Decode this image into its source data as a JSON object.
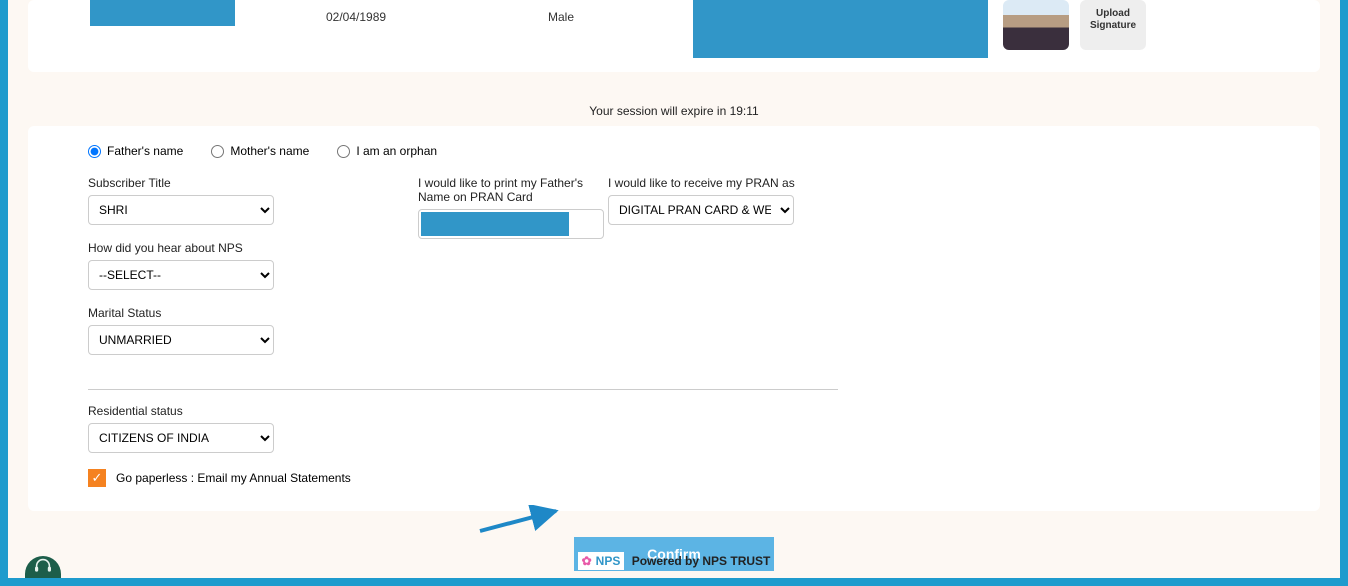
{
  "top": {
    "dob": "02/04/1989",
    "gender": "Male",
    "sig_line1": "Upload",
    "sig_line2": "Signature"
  },
  "session": {
    "prefix": "Your session will expire in ",
    "time": "19:11"
  },
  "radios": {
    "fathers": "Father's name",
    "mothers": "Mother's name",
    "orphan": "I am an orphan"
  },
  "labels": {
    "subscriber_title": "Subscriber Title",
    "print_father": "I would like to print my Father's Name on PRAN Card",
    "receive_pran_as": "I would like to receive my PRAN as",
    "how_hear": "How did you hear about NPS",
    "marital_status": "Marital Status",
    "residential_status": "Residential status",
    "paperless": "Go paperless : Email my Annual Statements"
  },
  "values": {
    "subscriber_title": "SHRI",
    "receive_pran_as": "DIGITAL PRAN CARD & WELCOM",
    "how_hear": "--SELECT--",
    "marital_status": "UNMARRIED",
    "residential_status": "CITIZENS OF INDIA"
  },
  "buttons": {
    "confirm": "Confirm"
  },
  "footer": {
    "powered": "Powered by NPS TRUST",
    "logo_text": "NPS"
  }
}
